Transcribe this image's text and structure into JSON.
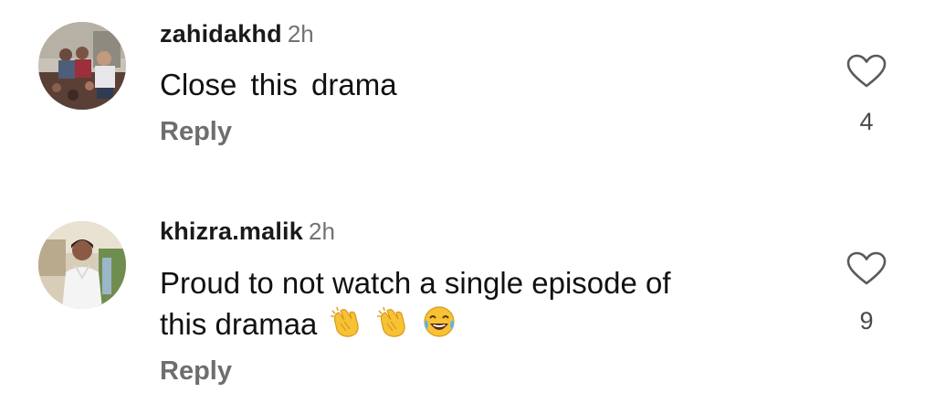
{
  "comments": [
    {
      "username": "zahidakhd",
      "time": "2h",
      "text": "Close this drama",
      "reply_label": "Reply",
      "likes": "4",
      "avatar_icon": "group-photo-avatar",
      "like_icon": "heart-outline-icon"
    },
    {
      "username": "khizra.malik",
      "time": "2h",
      "text_line1": "Proud to not watch a single episode of",
      "text_line2": "this dramaa",
      "emojis": [
        "clapping-hands-emoji",
        "clapping-hands-emoji",
        "face-with-tears-of-joy-emoji"
      ],
      "reply_label": "Reply",
      "likes": "9",
      "avatar_icon": "person-photo-avatar",
      "like_icon": "heart-outline-icon"
    }
  ],
  "colors": {
    "username": "#1a1a1a",
    "secondary_text": "#737373",
    "reply": "#6e6e6e",
    "background": "#ffffff"
  }
}
